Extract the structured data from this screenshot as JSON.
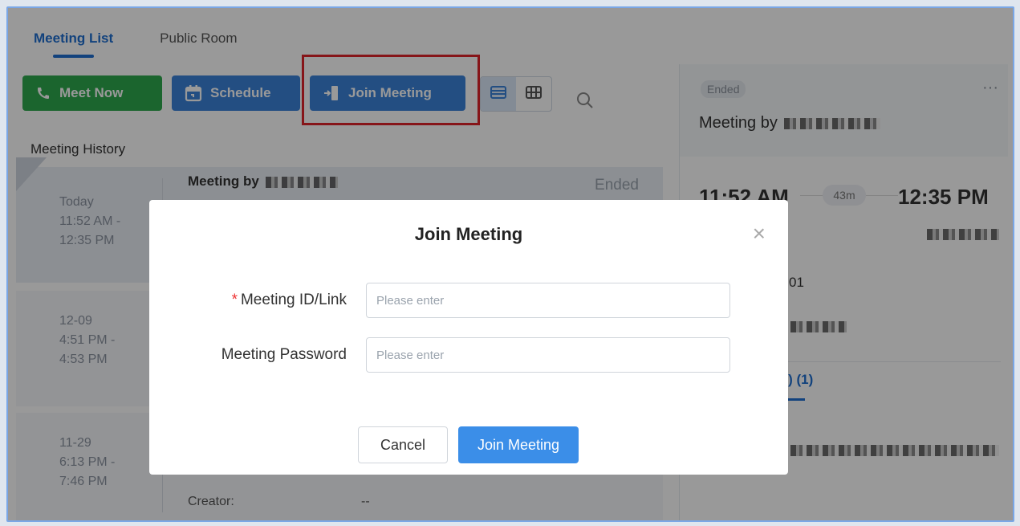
{
  "tabs": [
    {
      "label": "Meeting List",
      "active": true
    },
    {
      "label": "Public Room",
      "active": false
    }
  ],
  "toolbar": {
    "meet_now": "Meet Now",
    "schedule": "Schedule",
    "join_meeting": "Join Meeting"
  },
  "history": {
    "label": "Meeting History",
    "items": [
      {
        "date": "Today",
        "start": "11:52 AM -",
        "end": "12:35 PM",
        "title": "Meeting by",
        "status": "Ended"
      },
      {
        "date": "12-09",
        "start": "4:51 PM -",
        "end": "4:53 PM"
      },
      {
        "date": "11-29",
        "start": "6:13 PM -",
        "end": "7:46 PM",
        "creator_label": "Creator:",
        "creator_value": "--"
      }
    ]
  },
  "detail": {
    "status": "Ended",
    "more": "···",
    "title": "Meeting by",
    "start_time": "11:52 AM",
    "duration": "43m",
    "end_time": "12:35 PM",
    "id_fragment": "01",
    "participants_tab": "(s) (1)"
  },
  "dialog": {
    "title": "Join Meeting",
    "close": "×",
    "required_mark": "*",
    "id_label": "Meeting ID/Link",
    "id_placeholder": "Please enter",
    "password_label": "Meeting Password",
    "password_placeholder": "Please enter",
    "cancel": "Cancel",
    "submit": "Join Meeting"
  },
  "colors": {
    "accent": "#1f6fd1",
    "green": "#2ea84e",
    "primary_button": "#3b8ee8",
    "highlight": "#e0242a"
  }
}
